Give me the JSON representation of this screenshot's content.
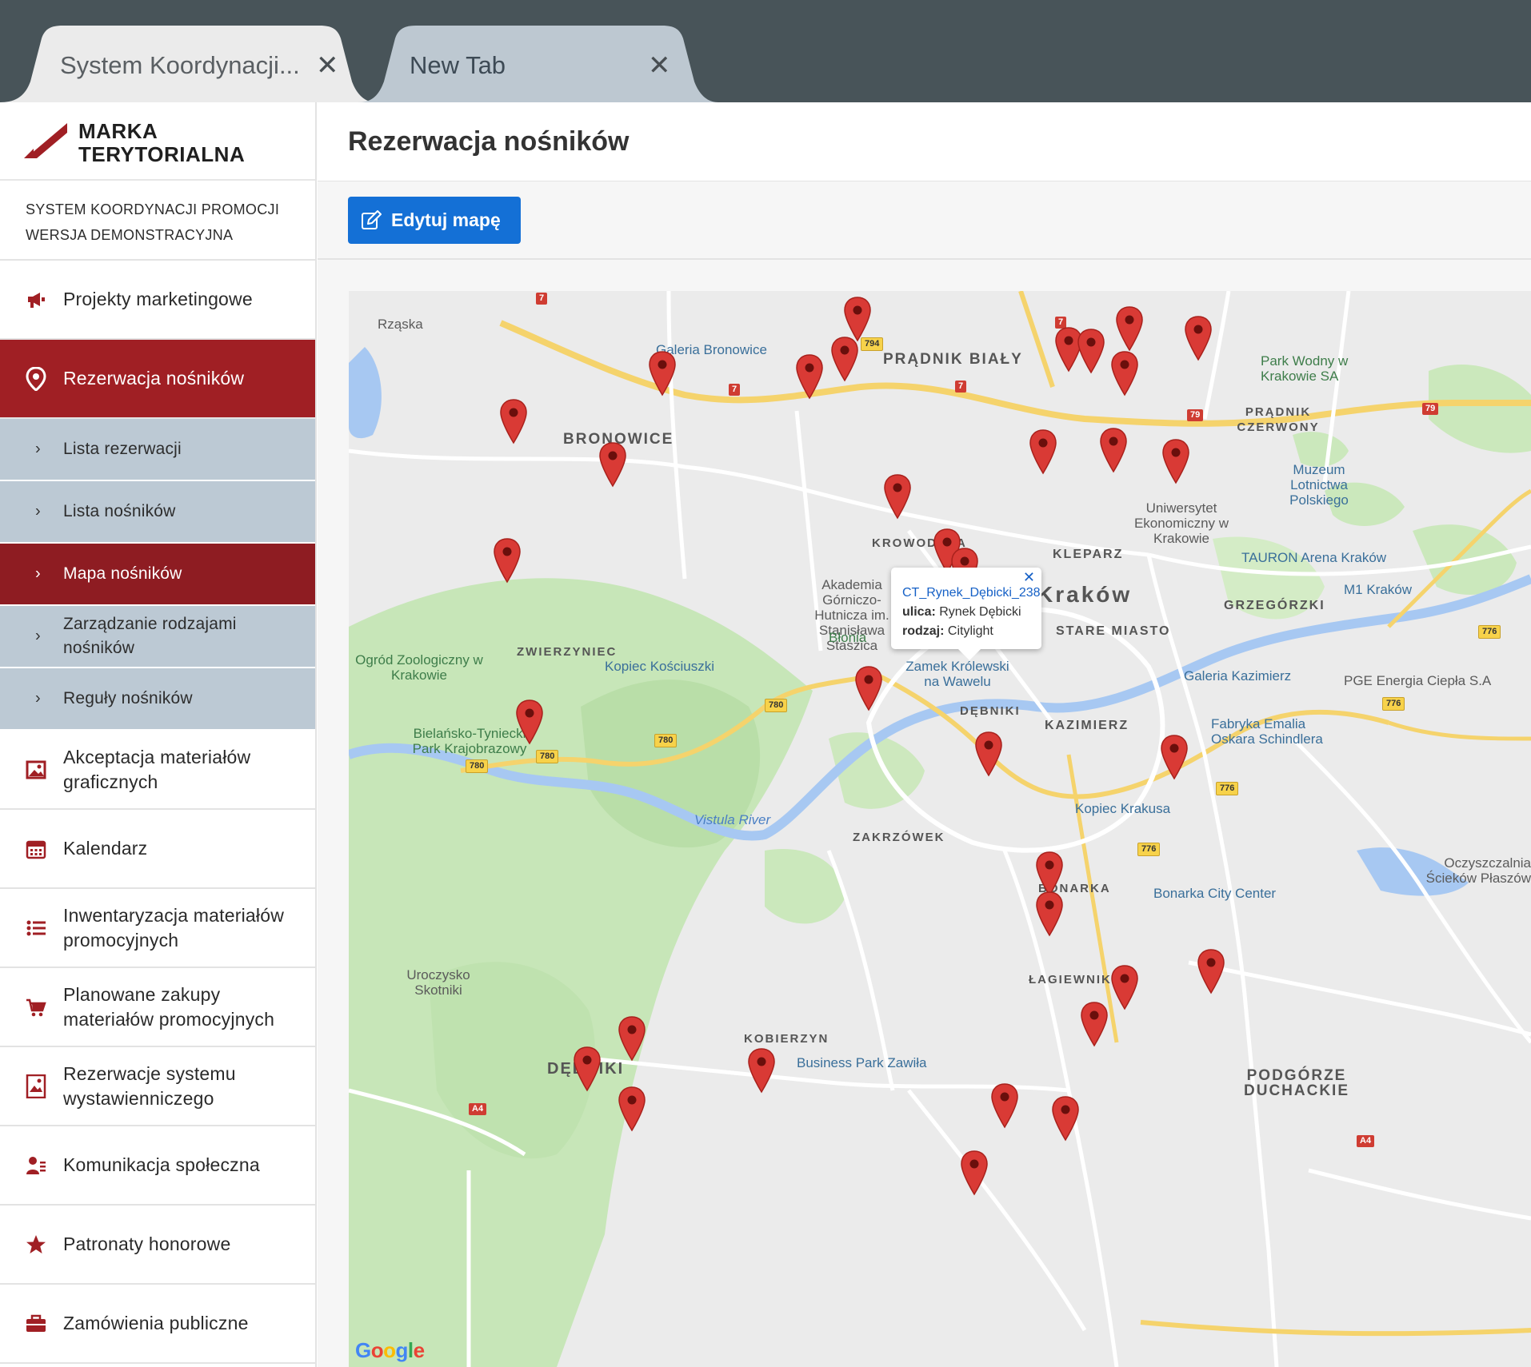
{
  "browser": {
    "tabs": [
      {
        "title": "System Koordynacji...",
        "active": true
      },
      {
        "title": "New Tab",
        "active": false
      }
    ]
  },
  "brand": {
    "line1": "MARKA",
    "line2": "TERYTORIALNA",
    "system_line1": "SYSTEM KOORDYNACJI PROMOCJI",
    "system_line2": "WERSJA DEMONSTRACYJNA",
    "accent": "#a01f24"
  },
  "sidebar": {
    "items": [
      {
        "label": "Projekty marketingowe",
        "icon": "megaphone-icon"
      },
      {
        "label": "Rezerwacja nośników",
        "icon": "map-pin-icon",
        "active": true
      },
      {
        "label": "Akceptacja materiałów graficznych",
        "icon": "image-icon"
      },
      {
        "label": "Kalendarz",
        "icon": "calendar-icon"
      },
      {
        "label": "Inwentaryzacja materiałów promocyjnych",
        "icon": "list-icon"
      },
      {
        "label": "Planowane zakupy materiałów promocyjnych",
        "icon": "cart-icon"
      },
      {
        "label": "Rezerwacje systemu wystawienniczego",
        "icon": "picture-frame-icon"
      },
      {
        "label": "Komunikacja społeczna",
        "icon": "person-card-icon"
      },
      {
        "label": "Patronaty honorowe",
        "icon": "star-icon"
      },
      {
        "label": "Zamówienia publiczne",
        "icon": "briefcase-icon"
      }
    ],
    "subitems": [
      {
        "label": "Lista rezerwacji"
      },
      {
        "label": "Lista nośników"
      },
      {
        "label": "Mapa nośników",
        "active": true
      },
      {
        "label": "Zarządzanie rodzajami nośników"
      },
      {
        "label": "Reguły nośników"
      }
    ]
  },
  "main": {
    "title": "Rezerwacja nośników",
    "edit_button": "Edytuj mapę"
  },
  "map": {
    "infowindow": {
      "title": "CT_Rynek_Dębicki_238",
      "street_label": "ulica:",
      "street_value": "Rynek Dębicki",
      "type_label": "rodzaj:",
      "type_value": "Citylight"
    },
    "labels": {
      "rzaska": "Rząska",
      "galeria_bronowice": "Galeria Bronowice",
      "pradnik_bialy": "PRĄDNIK BIAŁY",
      "bronowice": "BRONOWICE",
      "park": "Park Wodny w Krakowie SA",
      "pradnik_czerwony": "PRĄDNIK CZERWONY",
      "muzeum": "Muzeum Lotnictwa Polskiego",
      "uek": "Uniwersytet Ekonomiczny w Krakowie",
      "krowodrza": "KROWODRZA",
      "tauron": "TAURON Arena Kraków",
      "kleparz": "KLEPARZ",
      "akademia": "Akademia Górniczo-Hutnicza im. Stanisława Staszica",
      "krakow": "Kraków",
      "grzegorzki": "GRZEGÓRZKI",
      "m1": "M1 Kraków",
      "blonia": "Błonia",
      "stare_miasto": "STARE MIASTO",
      "zoo": "Ogród Zoologiczny w Krakowie",
      "zwierzyniec": "ZWIERZYNIEC",
      "kopiec_kosciuszki": "Kopiec Kościuszki",
      "wawel": "Zamek Królewski na Wawelu",
      "galeria_kazimierz": "Galeria Kazimierz",
      "pge": "PGE Energia Ciepła S.A",
      "bielany": "Bielańsko-Tyniecki Park Krajobrazowy",
      "debniki_north": "DĘBNIKI",
      "kazimierz": "KAZIMIERZ",
      "schindler": "Fabryka Emalia Oskara Schindlera",
      "vistula": "Vistula River",
      "kopiec_krakusa": "Kopiec Krakusa",
      "zakrzowek": "ZAKRZÓWEK",
      "oczyszczalnia": "Oczyszczalnia Ścieków Płaszów",
      "bonarka": "BONARKA",
      "bonarka_cc": "Bonarka City Center",
      "lagiewniki": "ŁAGIEWNIKI",
      "uroczysko": "Uroczysko Skotniki",
      "kobierzyn": "KOBIERZYN",
      "debniki_south": "DĘBNIKI",
      "business_park": "Business Park Zawiła",
      "podgorze": "PODGÓRZE DUCHACKIE",
      "google": "Google"
    },
    "pins_count": 34,
    "pin_color": "#d93a35"
  }
}
